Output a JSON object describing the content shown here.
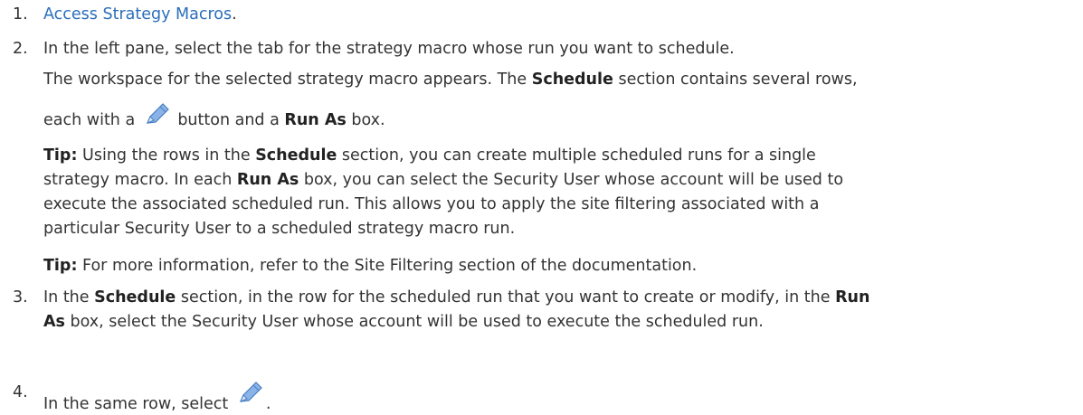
{
  "steps": [
    {
      "number": "1.",
      "link_text": "Access Strategy Macros",
      "after_link": "."
    },
    {
      "number": "2.",
      "line1": "In the left pane, select the tab for the strategy macro whose run you want to schedule.",
      "line2_pre": "The workspace for the selected strategy macro appears. The ",
      "line2_bold": "Schedule",
      "line2_post": " section contains several rows,",
      "line3_pre": "each with a ",
      "line3_mid": " button and a ",
      "line3_bold": "Run As",
      "line3_post": " box.",
      "tip1": {
        "label": "Tip:",
        "l1_pre": " Using the rows in the ",
        "l1_bold": "Schedule",
        "l1_post": " section, you can create multiple scheduled runs for a single",
        "l2_pre": "strategy macro. In each ",
        "l2_bold": "Run As",
        "l2_post": " box, you can select the Security User whose account will be used to",
        "l3": "execute the associated scheduled run. This allows you to apply the site filtering associated with a",
        "l4": "particular Security User to a scheduled strategy macro run."
      },
      "tip2": {
        "label": "Tip:",
        "text": " For more information, refer to the Site Filtering section of the documentation."
      }
    },
    {
      "number": "3.",
      "l1_pre": "In the ",
      "l1_bold": "Schedule",
      "l1_post": " section, in the row for the scheduled run that you want to create or modify, in the ",
      "l1_bold2": "Run",
      "l2_bold": "As",
      "l2_post": " box, select the Security User whose account will be used to execute the scheduled run."
    },
    {
      "number": "4.",
      "text_pre": "In the same row, select ",
      "text_post": "."
    }
  ],
  "icons": {
    "pencil": "pencil-icon"
  },
  "colors": {
    "link": "#2a6ebb",
    "text": "#333333",
    "pencil_body": "#8ab4e8",
    "pencil_outline": "#4a7fc4"
  }
}
